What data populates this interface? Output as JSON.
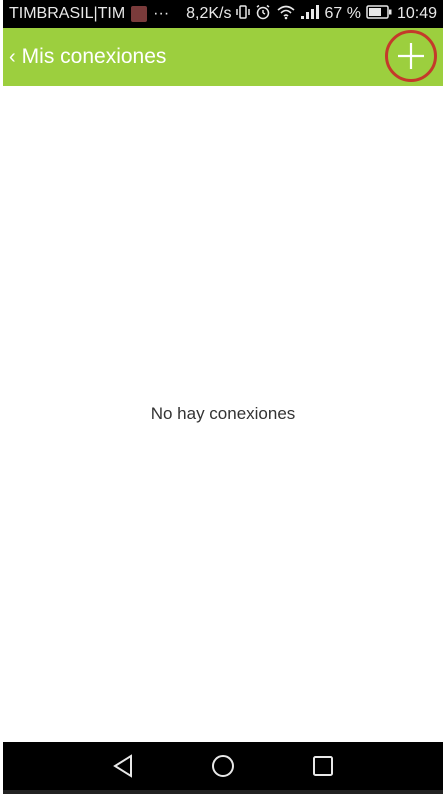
{
  "statusbar": {
    "carrier": "TIMBRASIL|TIM",
    "dots": "···",
    "speed": "8,2K/s",
    "battery": "67 %",
    "time": "10:49"
  },
  "toolbar": {
    "title": "Mis conexiones",
    "back_glyph": "‹"
  },
  "content": {
    "empty_message": "No hay conexiones"
  },
  "colors": {
    "toolbar": "#9ccf3e",
    "highlight": "#c43a2a"
  },
  "icons": [
    "back-chevron-icon",
    "add-icon",
    "vibrate-icon",
    "alarm-icon",
    "wifi-icon",
    "signal-icon",
    "battery-icon",
    "nav-back-icon",
    "nav-home-icon",
    "nav-recents-icon"
  ]
}
